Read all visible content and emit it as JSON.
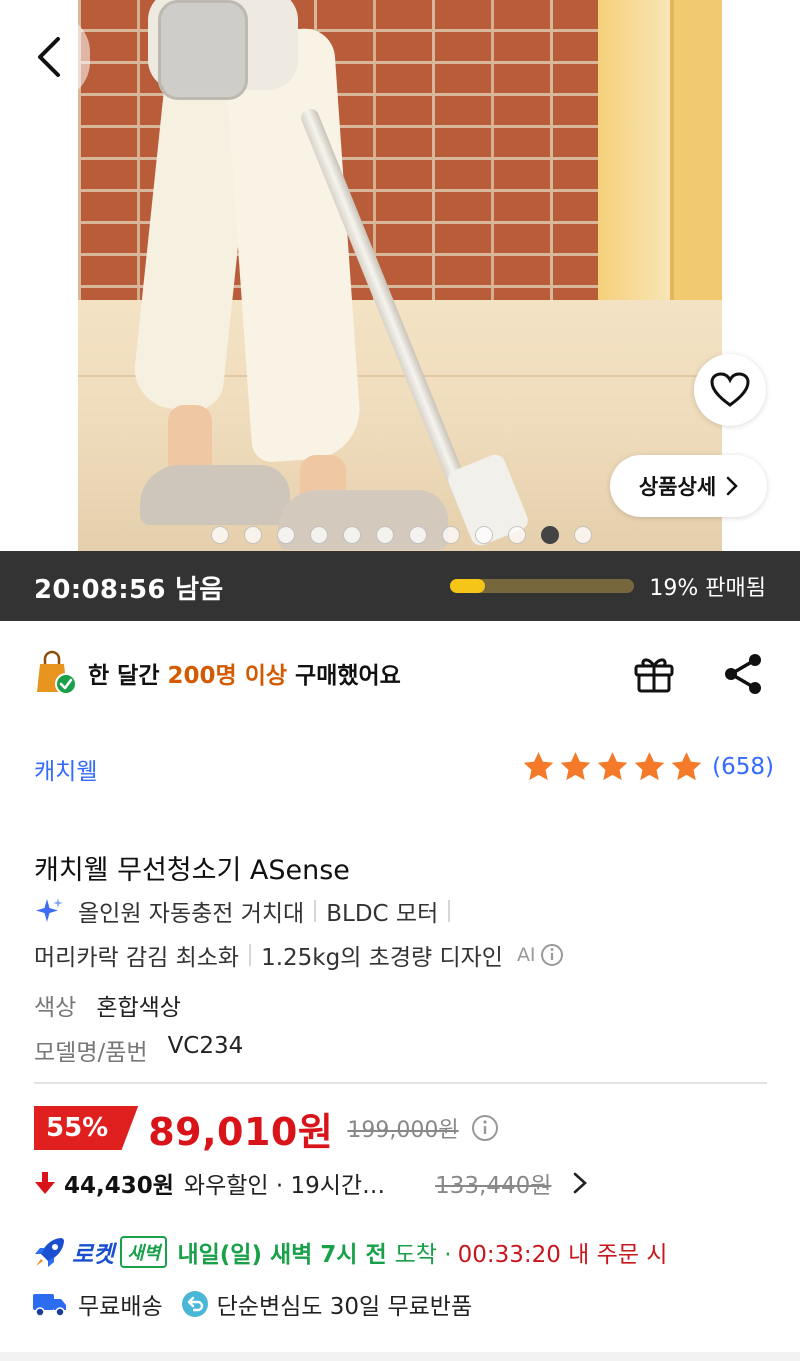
{
  "hero": {
    "detail_button_label": "상품상세",
    "image_count": 12,
    "active_image_index": 10
  },
  "timer_bar": {
    "remaining_time": "20:08:56 남음",
    "sold_percent": 19,
    "sold_text": "19% 판매됨",
    "colors": {
      "background": "#333333",
      "progress_fill": "#f5c518",
      "progress_track": "#76673d"
    }
  },
  "purchase_info": {
    "prefix": "한 달간",
    "highlight": "200명 이상",
    "suffix": "구매했어요"
  },
  "brand": {
    "name": "캐치웰"
  },
  "rating": {
    "stars": 5,
    "review_count": "(658)"
  },
  "product": {
    "title": "캐치웰 무선청소기 ASense",
    "ai_features": [
      "올인원 자동충전 거치대",
      "BLDC 모터",
      "머리카락 감김 최소화",
      "1.25kg의 초경량 디자인"
    ],
    "ai_label": "AI",
    "specs": [
      {
        "key": "색상",
        "value": "혼합색상"
      },
      {
        "key": "모델명/품번",
        "value": "VC234"
      }
    ]
  },
  "price": {
    "discount": "55%",
    "sale_price": "89,010원",
    "original_price": "199,000원",
    "wow_price": "44,430원",
    "wow_label": "와우할인 · 19시간…",
    "wow_original_price": "133,440원",
    "colors": {
      "sale": "#d9131a",
      "badge": "#e0201f"
    }
  },
  "delivery": {
    "rocket_label": "로켓",
    "dawn_label": "새벽",
    "eta_bold": "내일(일) 새벽 7시 전",
    "eta_rest": "도착 ·",
    "deadline": "00:33:20 내 주문 시",
    "free_shipping": "무료배송",
    "return_policy": "단순변심도 30일 무료반품",
    "colors": {
      "rocket": "#1a4fcf",
      "eta": "#18a148",
      "deadline": "#c8161d"
    }
  }
}
